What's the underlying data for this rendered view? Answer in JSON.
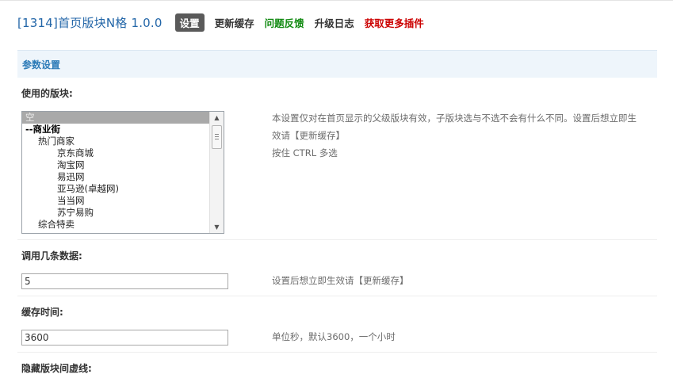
{
  "header": {
    "title": "[1314]首页版块N格 1.0.0",
    "nav": [
      {
        "label": "设置",
        "style": "active"
      },
      {
        "label": "更新缓存",
        "style": "plain"
      },
      {
        "label": "问题反馈",
        "style": "green"
      },
      {
        "label": "升级日志",
        "style": "plain"
      },
      {
        "label": "获取更多插件",
        "style": "red"
      }
    ]
  },
  "section": {
    "title": "参数设置"
  },
  "fields": {
    "forums": {
      "label": "使用的版块:",
      "options": [
        {
          "text": "空",
          "indent": 0,
          "selected": true,
          "bold": false
        },
        {
          "text": "--商业街",
          "indent": 0,
          "selected": false,
          "bold": true
        },
        {
          "text": "热门商家",
          "indent": 1,
          "selected": false,
          "bold": false
        },
        {
          "text": "京东商城",
          "indent": 2,
          "selected": false,
          "bold": false
        },
        {
          "text": "淘宝网",
          "indent": 2,
          "selected": false,
          "bold": false
        },
        {
          "text": "易迅网",
          "indent": 2,
          "selected": false,
          "bold": false
        },
        {
          "text": "亚马逊(卓越网)",
          "indent": 2,
          "selected": false,
          "bold": false
        },
        {
          "text": "当当网",
          "indent": 2,
          "selected": false,
          "bold": false
        },
        {
          "text": "苏宁易购",
          "indent": 2,
          "selected": false,
          "bold": false
        },
        {
          "text": "综合特卖",
          "indent": 1,
          "selected": false,
          "bold": false
        }
      ],
      "hint_lines": [
        "本设置仅对在首页显示的父级版块有效，子版块选与不选不会有什么不同。设置后想立即生",
        "效请【更新缓存】",
        "按住 CTRL 多选"
      ]
    },
    "count": {
      "label": "调用几条数据:",
      "value": "5",
      "hint": "设置后想立即生效请【更新缓存】"
    },
    "cache": {
      "label": "缓存时间:",
      "value": "3600",
      "hint": "单位秒，默认3600，一个小时"
    },
    "dashed": {
      "label": "隐藏版块间虚线:"
    }
  },
  "colors": {
    "title": "#2366a8",
    "section_bg": "#eef5fb",
    "section_title": "#2e7cb8",
    "green": "#118a11",
    "red": "#cc0000"
  }
}
